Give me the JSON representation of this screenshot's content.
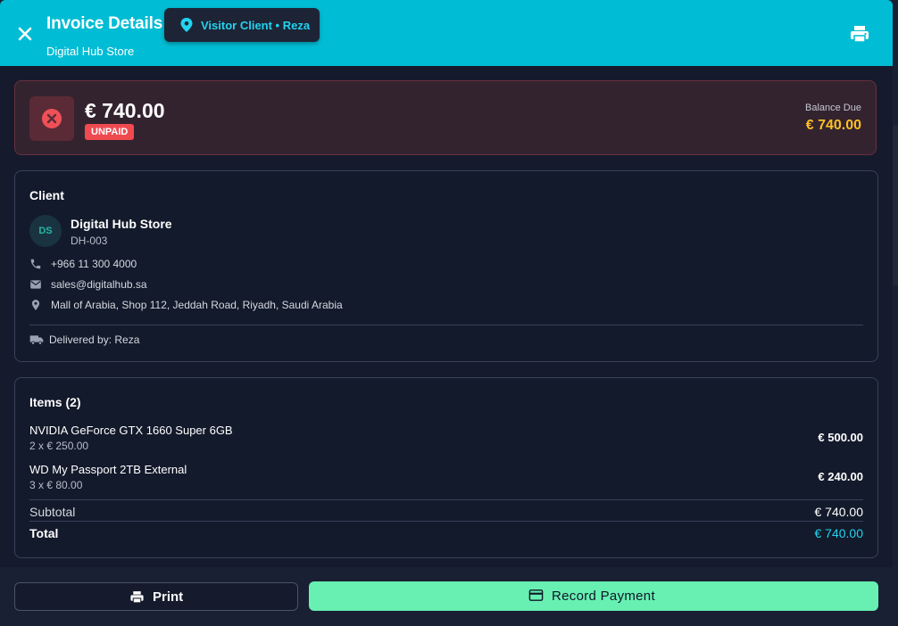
{
  "header": {
    "title": "Invoice Details",
    "subtitle": "Digital Hub Store",
    "chip_label": "Visitor Client • Reza",
    "icons": {
      "close": "close-icon",
      "chip": "location-pin-icon",
      "print": "printer-icon"
    }
  },
  "status": {
    "amount": "€ 740.00",
    "badge": "UNPAID",
    "balance_label": "Balance Due",
    "balance_value": "€ 740.00",
    "icon": "close-circle-icon"
  },
  "client": {
    "section_title": "Client",
    "avatar_initials": "DS",
    "name": "Digital Hub Store",
    "code": "DH-003",
    "phone": "+966 11 300 4000",
    "email": "sales@digitalhub.sa",
    "address": "Mall of Arabia, Shop 112, Jeddah Road, Riyadh, Saudi Arabia",
    "delivered_by": "Delivered by: Reza"
  },
  "items": {
    "section_title": "Items (2)",
    "rows": [
      {
        "name": "NVIDIA GeForce GTX 1660 Super 6GB",
        "qty": "2 x € 250.00",
        "total": "€ 500.00"
      },
      {
        "name": "WD My Passport 2TB External",
        "qty": "3 x € 80.00",
        "total": "€ 240.00"
      }
    ],
    "subtotal_label": "Subtotal",
    "subtotal_value": "€ 740.00",
    "total_label": "Total",
    "total_value": "€ 740.00"
  },
  "footer": {
    "print_label": "Print",
    "record_label": "Record Payment"
  },
  "colors": {
    "header_bg": "#00bcd4",
    "accent_cyan": "#22d3ee",
    "unpaid_red": "#ef4a50",
    "balance_amber": "#fbbf24",
    "record_green": "#67f0b2"
  }
}
